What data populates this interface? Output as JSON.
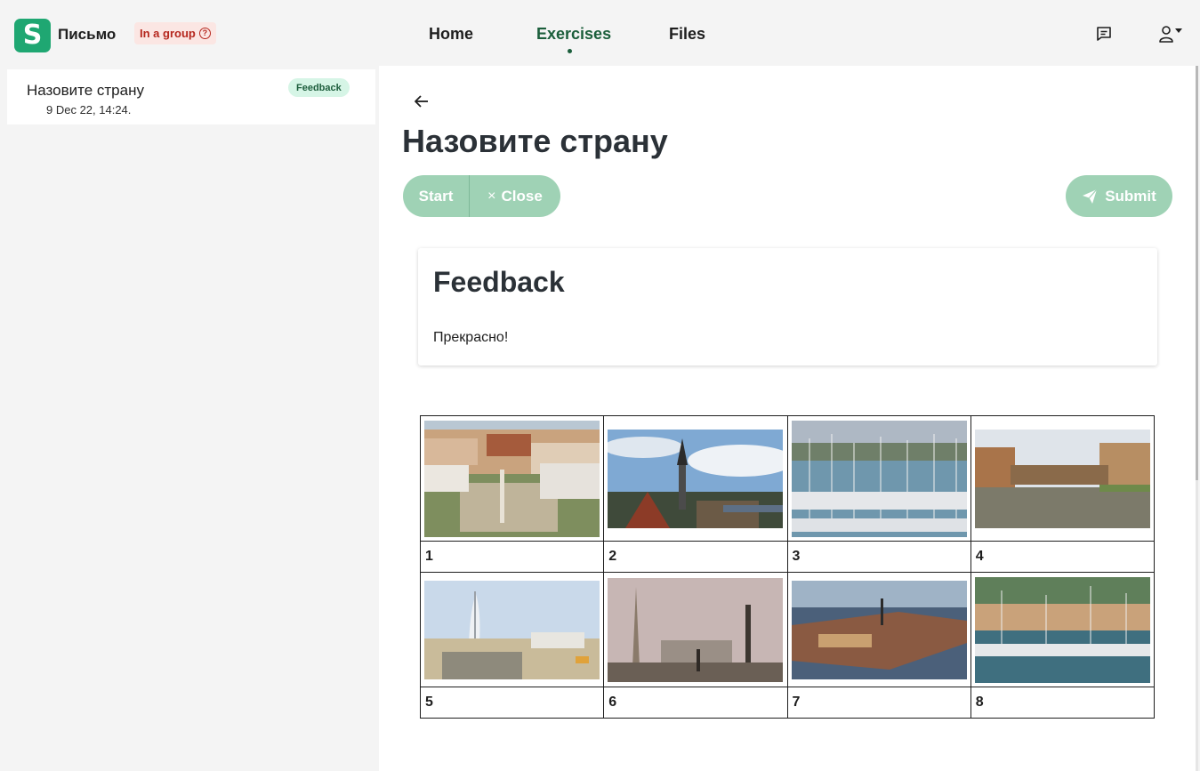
{
  "header": {
    "app_name": "Письмо",
    "logo_letter": "S",
    "group_badge": "In a group",
    "help_glyph": "?",
    "nav": [
      {
        "label": "Home",
        "active": false
      },
      {
        "label": "Exercises",
        "active": true
      },
      {
        "label": "Files",
        "active": false
      }
    ],
    "icons": [
      "message-icon",
      "user-menu-icon"
    ]
  },
  "sidebar": {
    "items": [
      {
        "title": "Назовите страну",
        "date": "9 Dec 22, 14:24.",
        "badge": "Feedback"
      }
    ]
  },
  "main": {
    "title": "Назовите страну",
    "buttons": {
      "start": "Start",
      "close": "Close",
      "close_glyph": "×",
      "submit": "Submit"
    },
    "feedback": {
      "heading": "Feedback",
      "text": "Прекрасно!"
    },
    "photos": [
      {
        "number": "1",
        "scene": "city-square-aerial"
      },
      {
        "number": "2",
        "scene": "old-town-spire"
      },
      {
        "number": "3",
        "scene": "marina-yachts"
      },
      {
        "number": "4",
        "scene": "river-bridge"
      },
      {
        "number": "5",
        "scene": "sail-hotel-coast"
      },
      {
        "number": "6",
        "scene": "obelisk-square"
      },
      {
        "number": "7",
        "scene": "island-city-aerial"
      },
      {
        "number": "8",
        "scene": "harbour-boats"
      }
    ]
  },
  "colors": {
    "brand": "#1fa772",
    "active_nav": "#1b5e3b",
    "button": "#9fd2b5",
    "badge_bg": "#d6f5e6",
    "group_badge_bg": "#fbe6e3",
    "group_badge_text": "#b5271e"
  }
}
